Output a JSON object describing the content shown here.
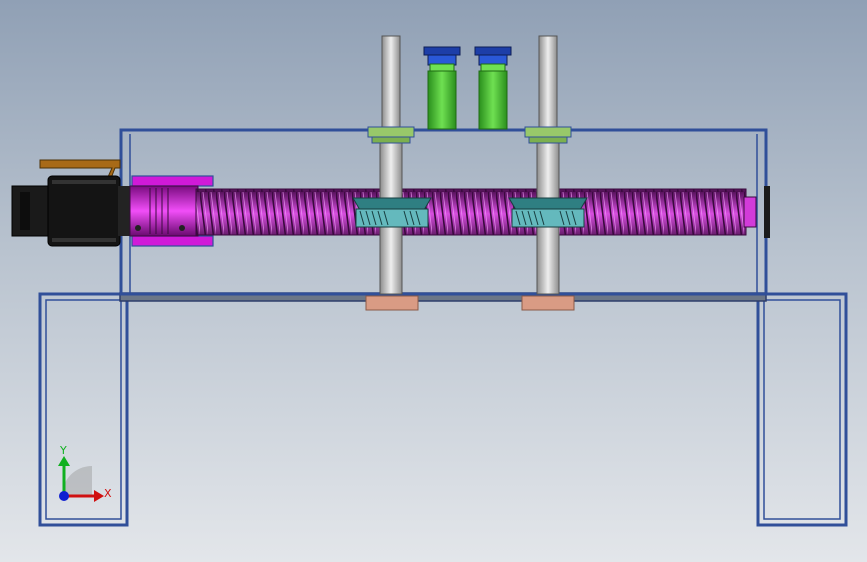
{
  "viewport": {
    "background_top": "#90a0b5",
    "background_bottom": "#e3e6ea"
  },
  "model": {
    "frame_color": "#304f99",
    "motor_color": "#151515",
    "coupling_color": "#d01ad8",
    "screw_color": "#8a1f8f",
    "nut_color": "#2f7f82",
    "shaft_color": "#c9c9c9",
    "collar_color": "#98c86a",
    "bushing_color": "#d99b84",
    "cup_color": "#1d3ea8",
    "cup_body_color": "#4fc93a",
    "bracket_color": "#a86a17"
  },
  "triad": {
    "x_label": "X",
    "y_label": "Y",
    "x_color": "#d01010",
    "y_color": "#10b020",
    "z_color": "#1020d0"
  }
}
